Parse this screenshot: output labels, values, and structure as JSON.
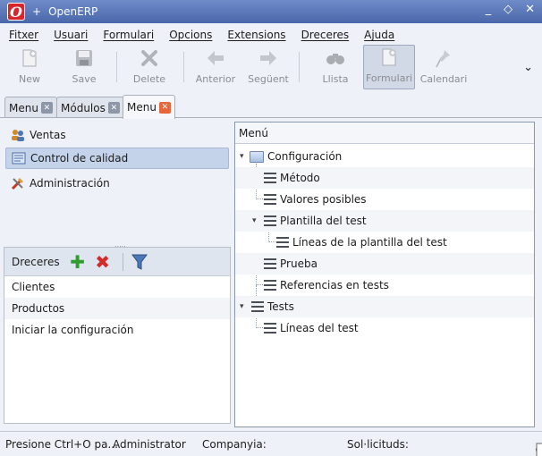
{
  "window": {
    "title": "OpenERP",
    "plus": "+"
  },
  "menubar": [
    "Fitxer",
    "Usuari",
    "Formulari",
    "Opcions",
    "Extensions",
    "Dreceres",
    "Ajuda"
  ],
  "toolbar": {
    "new": "New",
    "save": "Save",
    "delete": "Delete",
    "previous": "Anterior",
    "next": "Següent",
    "list": "Llista",
    "form": "Formulari",
    "calendar": "Calendari"
  },
  "tabs": [
    "Menu",
    "Módulos",
    "Menu"
  ],
  "modules": [
    "Ventas",
    "Control de calidad",
    "Administración"
  ],
  "shortcuts": {
    "title": "Dreceres",
    "items": [
      "Clientes",
      "Productos",
      "Iniciar la configuración"
    ]
  },
  "menu_tree": {
    "header": "Menú",
    "items": [
      "Configuración",
      "Método",
      "Valores posibles",
      "Plantilla del test",
      "Líneas de la plantilla del test",
      "Prueba",
      "Referencias en tests",
      "Tests",
      "Líneas del test"
    ]
  },
  "status": {
    "hint": "Presione Ctrl+O pa...",
    "user": "Administrator",
    "company": "Companyia:",
    "requests": "Sol·licituds:"
  },
  "colors": {
    "titlebar": "#5570b6",
    "tab_close_active": "#e8673a",
    "add_green": "#2f9e2f",
    "remove_red": "#d42a2a"
  }
}
